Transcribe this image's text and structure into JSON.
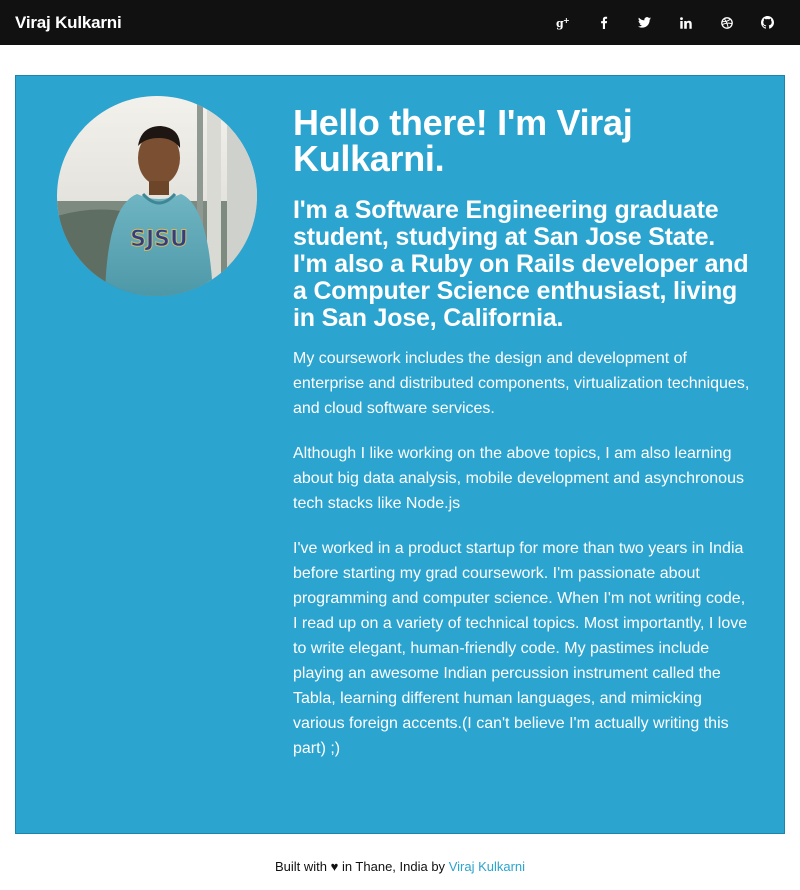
{
  "navbar": {
    "brand": "Viraj Kulkarni",
    "social_icons": [
      "google-plus-icon",
      "facebook-icon",
      "twitter-icon",
      "linkedin-icon",
      "dribbble-icon",
      "github-icon"
    ]
  },
  "profile": {
    "heading": "Hello there! I'm Viraj Kulkarni.",
    "subheading": "I'm a Software Engineering graduate student, studying at San Jose State. I'm also a Ruby on Rails developer and a Computer Science enthusiast, living in San Jose, California.",
    "paragraphs": [
      "My coursework includes the design and development of enterprise and distributed components, virtualization techniques, and cloud software services.",
      "Although I like working on the above topics, I am also learning about big data analysis, mobile development and asynchronous tech stacks like Node.js",
      "I've worked in a product startup for more than two years in India before starting my grad coursework. I'm passionate about programming and computer science. When I'm not writing code, I read up on a variety of technical topics. Most importantly, I love to write elegant, human-friendly code. My pastimes include playing an awesome Indian percussion instrument called the Tabla, learning different human languages, and mimicking various foreign accents.(I can't believe I'm actually writing this part) ;)"
    ]
  },
  "footer": {
    "prefix": "Built with",
    "heart": "♥",
    "middle": "in Thane, India by",
    "author_link": "Viraj Kulkarni"
  },
  "colors": {
    "navbar_bg": "#111111",
    "card_bg": "#2ba4cf",
    "link": "#2ba4cf"
  }
}
